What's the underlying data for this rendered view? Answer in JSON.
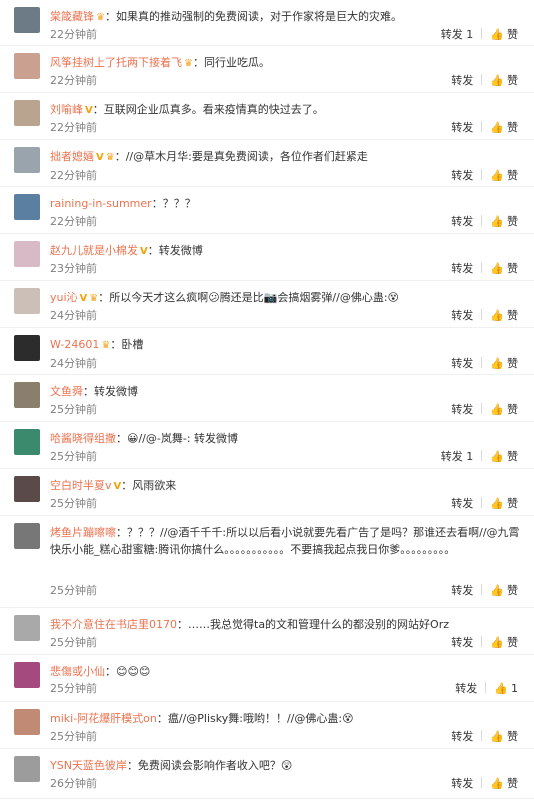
{
  "comments": [
    {
      "user": "棠箴藏锋",
      "badges": [
        "crown"
      ],
      "text": "：如果真的推动强制的免费阅读，对于作家将是巨大的灾难。",
      "time": "22分钟前",
      "repost": "转发",
      "repost_count": "1",
      "like": "赞",
      "like_count": "",
      "avatar_color": "#6d7b86"
    },
    {
      "user": "风筝挂树上了托两下接着飞",
      "badges": [
        "crown"
      ],
      "text": "：同行业吃瓜。",
      "time": "22分钟前",
      "repost": "转发",
      "repost_count": "",
      "like": "赞",
      "like_count": "",
      "avatar_color": "#caa090"
    },
    {
      "user": "刘喻峰",
      "badges": [
        "v"
      ],
      "text": "：互联网企业瓜真多。看来疫情真的快过去了。",
      "time": "22分钟前",
      "repost": "转发",
      "repost_count": "",
      "like": "赞",
      "like_count": "",
      "avatar_color": "#b9a58f"
    },
    {
      "user": "拙者媳婳",
      "badges": [
        "v",
        "crown"
      ],
      "text": "：//@草木月华:要是真免费阅读，各位作者们赶紧走",
      "time": "22分钟前",
      "repost": "转发",
      "repost_count": "",
      "like": "赞",
      "like_count": "",
      "avatar_color": "#9aa4ad"
    },
    {
      "user": "raining-in-summer",
      "badges": [],
      "text": "：？？？",
      "time": "22分钟前",
      "repost": "转发",
      "repost_count": "",
      "like": "赞",
      "like_count": "",
      "avatar_color": "#5b7fa0"
    },
    {
      "user": "赵九儿就是小棉发",
      "badges": [
        "v"
      ],
      "text": "：转发微博",
      "time": "23分钟前",
      "repost": "转发",
      "repost_count": "",
      "like": "赞",
      "like_count": "",
      "avatar_color": "#d8b9c6"
    },
    {
      "user": "yui沁",
      "badges": [
        "v",
        "crown"
      ],
      "text": "：所以今天才这么疯啊😕腾还是比📷会搞烟雾弹//@佛心蛊:😵",
      "time": "24分钟前",
      "repost": "转发",
      "repost_count": "",
      "like": "赞",
      "like_count": "",
      "avatar_color": "#cbbfb7"
    },
    {
      "user": "W-24601",
      "badges": [
        "crown"
      ],
      "text": "：卧槽",
      "time": "24分钟前",
      "repost": "转发",
      "repost_count": "",
      "like": "赞",
      "like_count": "",
      "avatar_color": "#2c2c2c"
    },
    {
      "user": "文鱼舜",
      "badges": [],
      "text": "：转发微博",
      "time": "25分钟前",
      "repost": "转发",
      "repost_count": "",
      "like": "赞",
      "like_count": "",
      "avatar_color": "#8a7f6c"
    },
    {
      "user": "哈酱晓得组撒",
      "badges": [],
      "text": "：😀//@-岚舞-: 转发微博",
      "time": "25分钟前",
      "repost": "转发",
      "repost_count": "1",
      "like": "赞",
      "like_count": "",
      "avatar_color": "#3b8a6e"
    },
    {
      "user": "空白时半夏v",
      "badges": [
        "v"
      ],
      "text": "：风雨欲来",
      "time": "25分钟前",
      "repost": "转发",
      "repost_count": "",
      "like": "赞",
      "like_count": "",
      "avatar_color": "#5a4a48"
    },
    {
      "user": "烤鱼片蹦嚓嚓",
      "badges": [],
      "text": "：？？？//@酒千千千:所以以后看小说就要先看广告了是吗？那谁还去看啊//@九霄快乐小能_糕心甜蜜糖:腾讯你搞什么。。。。。。。。。。。不要搞我起点我日你爹。。。。。。。。。",
      "time": "25分钟前",
      "repost": "转发",
      "repost_count": "",
      "like": "赞",
      "like_count": "",
      "avatar_color": "#777777"
    },
    {
      "user": "我不介意住在书店里0170",
      "badges": [],
      "text": "：……我总觉得ta的文和管理什么的都没别的网站好Orz",
      "time": "25分钟前",
      "repost": "转发",
      "repost_count": "",
      "like": "赞",
      "like_count": "",
      "avatar_color": "#a9a9a9"
    },
    {
      "user": "悲傷或小仙",
      "badges": [],
      "text": "：😊😊😊",
      "time": "25分钟前",
      "repost": "转发",
      "repost_count": "",
      "like": "",
      "like_count": "1",
      "avatar_color": "#a44a7e"
    },
    {
      "user": "miki-阿花爆肝模式on",
      "badges": [],
      "text": "：瘟//@Plisky舞:哦哟！！//@佛心蛊:😵",
      "time": "25分钟前",
      "repost": "转发",
      "repost_count": "",
      "like": "赞",
      "like_count": "",
      "avatar_color": "#c08a74"
    },
    {
      "user": "YSN天蓝色彼岸",
      "badges": [],
      "text": "：免费阅读会影响作者收入吧？😲",
      "time": "26分钟前",
      "repost": "转发",
      "repost_count": "",
      "like": "赞",
      "like_count": "",
      "avatar_color": "#9c9c9c"
    }
  ]
}
